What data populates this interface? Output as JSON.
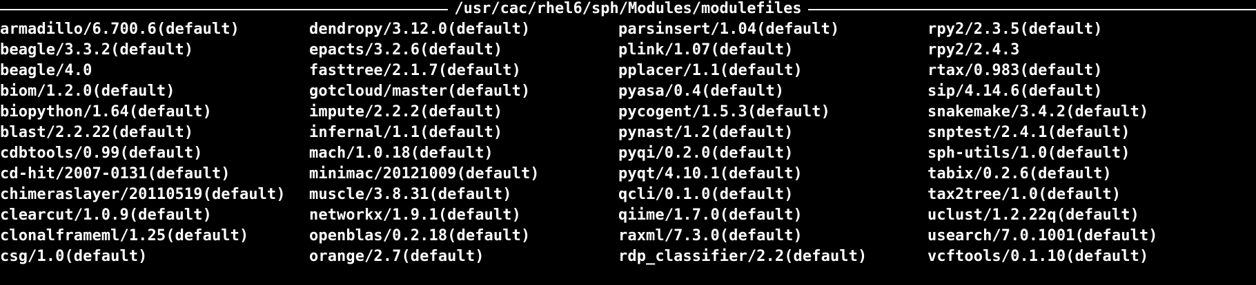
{
  "terminal": {
    "header_title": "/usr/cac/rhel6/sph/Modules/modulefiles"
  },
  "modules": {
    "col1": [
      "armadillo/6.700.6(default)",
      "beagle/3.3.2(default)",
      "beagle/4.0",
      "biom/1.2.0(default)",
      "biopython/1.64(default)",
      "blast/2.2.22(default)",
      "cdbtools/0.99(default)",
      "cd-hit/2007-0131(default)",
      "chimeraslayer/20110519(default)",
      "clearcut/1.0.9(default)",
      "clonalframeml/1.25(default)",
      "csg/1.0(default)"
    ],
    "col2": [
      "dendropy/3.12.0(default)",
      "epacts/3.2.6(default)",
      "fasttree/2.1.7(default)",
      "gotcloud/master(default)",
      "impute/2.2.2(default)",
      "infernal/1.1(default)",
      "mach/1.0.18(default)",
      "minimac/20121009(default)",
      "muscle/3.8.31(default)",
      "networkx/1.9.1(default)",
      "openblas/0.2.18(default)",
      "orange/2.7(default)"
    ],
    "col3": [
      "parsinsert/1.04(default)",
      "plink/1.07(default)",
      "pplacer/1.1(default)",
      "pyasa/0.4(default)",
      "pycogent/1.5.3(default)",
      "pynast/1.2(default)",
      "pyqi/0.2.0(default)",
      "pyqt/4.10.1(default)",
      "qcli/0.1.0(default)",
      "qiime/1.7.0(default)",
      "raxml/7.3.0(default)",
      "rdp_classifier/2.2(default)"
    ],
    "col4": [
      "rpy2/2.3.5(default)",
      "rpy2/2.4.3",
      "rtax/0.983(default)",
      "sip/4.14.6(default)",
      "snakemake/3.4.2(default)",
      "snptest/2.4.1(default)",
      "sph-utils/1.0(default)",
      "tabix/0.2.6(default)",
      "tax2tree/1.0(default)",
      "uclust/1.2.22q(default)",
      "usearch/7.0.1001(default)",
      "vcftools/0.1.10(default)"
    ]
  }
}
